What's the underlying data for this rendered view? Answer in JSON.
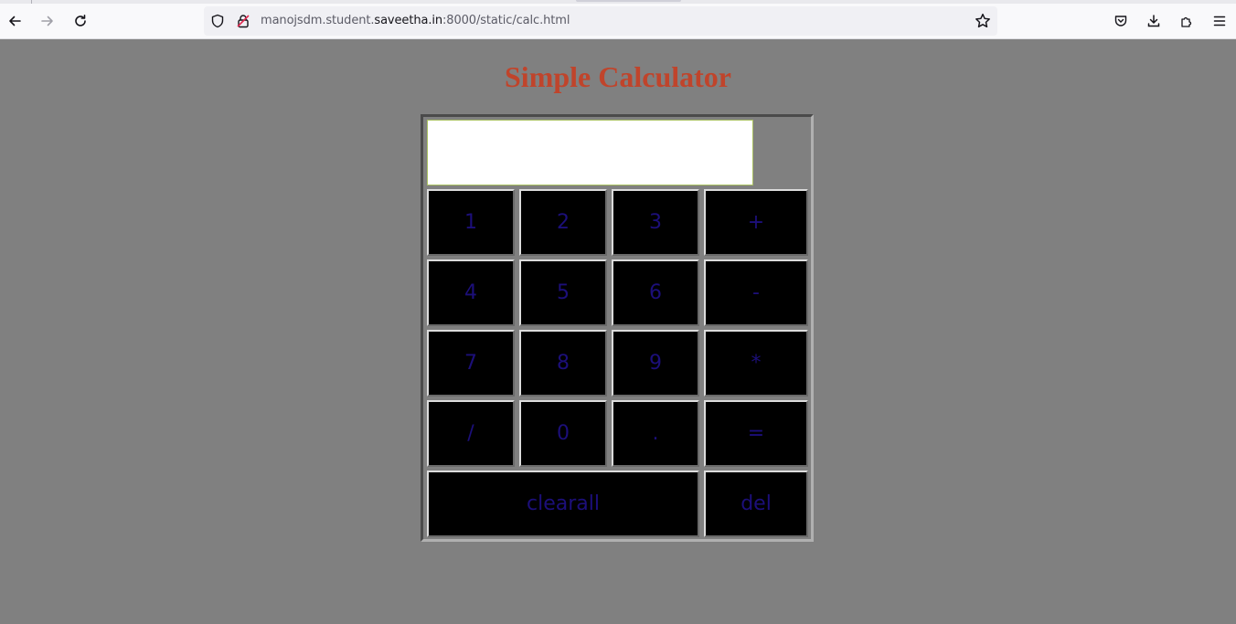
{
  "browser": {
    "url_prefix": "manojsdm.student.",
    "url_domain": "saveetha.in",
    "url_suffix": ":8000/static/calc.html",
    "icons": [
      "back-icon",
      "forward-icon",
      "reload-icon",
      "shield-icon",
      "lock-icon",
      "star-icon",
      "pocket-icon",
      "download-icon",
      "extensions-icon",
      "menu-icon"
    ]
  },
  "page": {
    "title": "Simple Calculator",
    "display_value": ""
  },
  "keys": {
    "k1": "1",
    "k2": "2",
    "k3": "3",
    "plus": "+",
    "k4": "4",
    "k5": "5",
    "k6": "6",
    "minus": "-",
    "k7": "7",
    "k8": "8",
    "k9": "9",
    "mul": "*",
    "div": "/",
    "k0": "0",
    "dot": ".",
    "eq": "=",
    "clear": "clearall",
    "del": "del"
  },
  "colors": {
    "background": "#808080",
    "title": "#c0442b",
    "key_bg": "#000000",
    "key_text": "#1c0f7a"
  }
}
